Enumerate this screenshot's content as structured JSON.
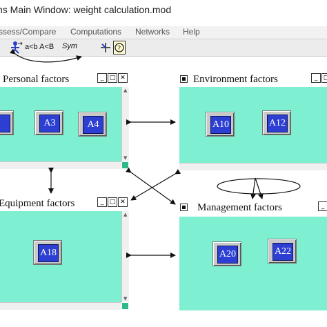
{
  "app": {
    "title": "ns Main Window: weight calculation.mod"
  },
  "menu": {
    "items": [
      "ssess/Compare",
      "Computations",
      "Networks",
      "Help"
    ]
  },
  "toolbar": {
    "compare_label": "a<b A<B",
    "sym_label": "Sym",
    "icons": [
      "person-arrow-icon",
      "crosshair-icon",
      "help-icon"
    ]
  },
  "windows": {
    "personal": {
      "title": "Personal factors",
      "nodes": [
        "",
        "A3",
        "A4"
      ]
    },
    "environment": {
      "title": "Environment factors",
      "nodes": [
        "A10",
        "A12"
      ]
    },
    "equipment": {
      "title": "Equipment factors",
      "nodes": [
        "A18"
      ]
    },
    "management": {
      "title": "Management factors",
      "nodes": [
        "A20",
        "A22"
      ]
    }
  },
  "controls": {
    "minimize": "_",
    "maximize": "□",
    "close": "✕"
  },
  "colors": {
    "panel": "#7fefd1",
    "node": "#2c3fd2"
  }
}
